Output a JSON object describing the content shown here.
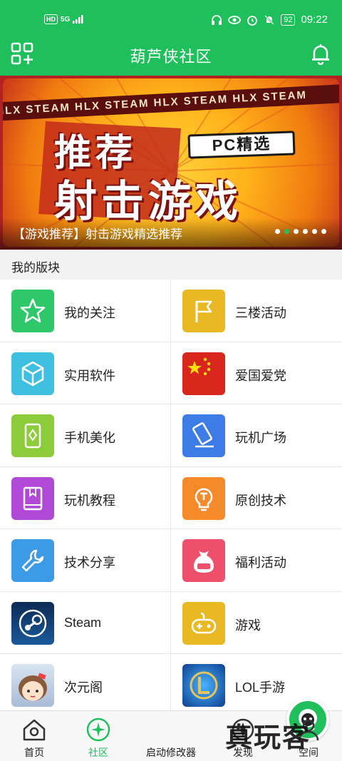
{
  "status_bar": {
    "network_hd": "HD",
    "network_5g": "5G",
    "battery": "92",
    "time": "09:22"
  },
  "header": {
    "title": "葫芦侠社区",
    "left_icon": "grid-plus-icon",
    "right_icon": "bell-icon"
  },
  "banner": {
    "strip_text": "HLX STEAM  HLX STEAM  HLX STEAM  HLX STEAM",
    "line1": "推荐",
    "line2": "射击游戏",
    "tag": "PC精选",
    "caption": "【游戏推荐】射击游戏精选推荐",
    "dots_total": 6,
    "dots_active_index": 1
  },
  "section": {
    "title": "我的版块"
  },
  "boards": [
    {
      "label": "我的关注",
      "icon": "star-icon",
      "color": "#2ec76a"
    },
    {
      "label": "三楼活动",
      "icon": "flag-icon",
      "color": "#e8b923"
    },
    {
      "label": "实用软件",
      "icon": "cube-icon",
      "color": "#3fc0e0"
    },
    {
      "label": "爱国爱党",
      "icon": "china-flag-icon",
      "color": "#d9261c"
    },
    {
      "label": "手机美化",
      "icon": "phone-diamond-icon",
      "color": "#8ccc3a"
    },
    {
      "label": "玩机广场",
      "icon": "tablet-icon",
      "color": "#3d7be6"
    },
    {
      "label": "玩机教程",
      "icon": "book-icon",
      "color": "#b04ad6"
    },
    {
      "label": "原创技术",
      "icon": "bulb-icon",
      "color": "#f58a2a"
    },
    {
      "label": "技术分享",
      "icon": "wrench-icon",
      "color": "#3d9be6"
    },
    {
      "label": "福利活动",
      "icon": "lucky-bag-icon",
      "color": "#ee4f6a"
    },
    {
      "label": "Steam",
      "icon": "steam-icon",
      "color": "#1a3a6b"
    },
    {
      "label": "游戏",
      "icon": "gamepad-icon",
      "color": "#e8b923"
    },
    {
      "label": "次元阁",
      "icon": "anime-avatar-icon",
      "color": "#c9d6e8"
    },
    {
      "label": "LOL手游",
      "icon": "lol-icon",
      "color": "#1f6fd8"
    }
  ],
  "tabs": [
    {
      "label": "首页",
      "icon": "home-icon"
    },
    {
      "label": "社区",
      "icon": "community-icon",
      "active": true
    },
    {
      "label": "启动修改器",
      "icon": "launcher-icon"
    },
    {
      "label": "发现",
      "icon": "discover-icon"
    },
    {
      "label": "空间",
      "icon": "space-icon"
    }
  ],
  "watermark": "真玩客",
  "colors": {
    "brand_green": "#1fbf5c",
    "banner_red": "#b22222"
  }
}
